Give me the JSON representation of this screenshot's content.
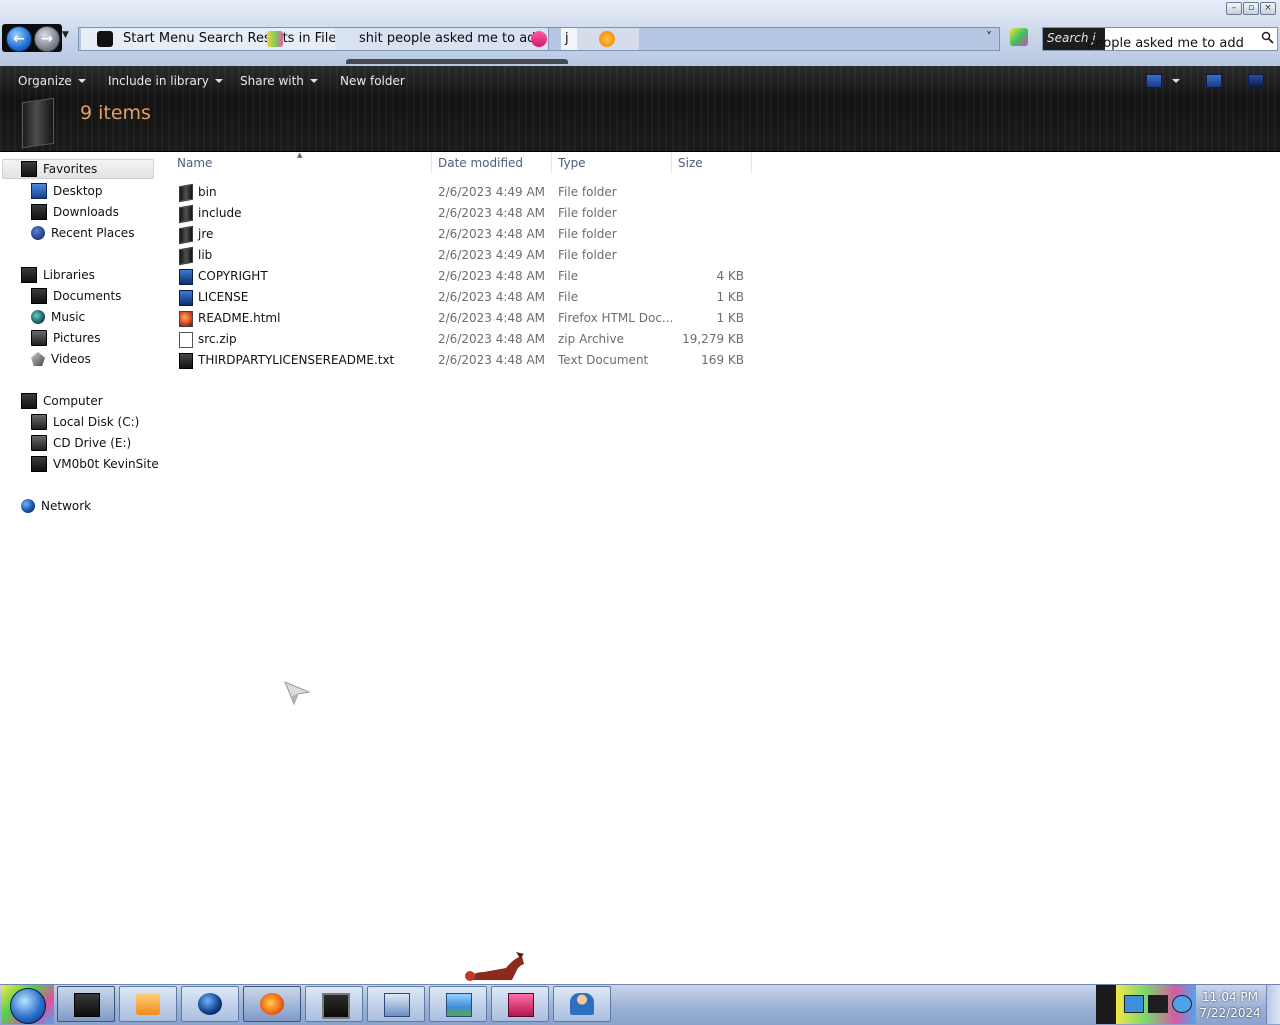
{
  "window": {
    "controls": [
      "minimize",
      "maximize",
      "close"
    ]
  },
  "address_bar": {
    "crumbs": [
      "Start Menu Search Results in Files",
      "shit people asked me to add",
      "j",
      ""
    ],
    "dropdown_glyph": "˅",
    "search_placeholder": "Search j",
    "search_echo": "people asked me to add"
  },
  "command_bar": {
    "organize": "Organize",
    "include_in_library": "Include in library",
    "share_with": "Share with",
    "new_folder": "New folder"
  },
  "details": {
    "item_count": "9 items"
  },
  "navigation": {
    "favorites": {
      "label": "Favorites",
      "items": [
        "Desktop",
        "Downloads",
        "Recent Places"
      ]
    },
    "libraries": {
      "label": "Libraries",
      "items": [
        "Documents",
        "Music",
        "Pictures",
        "Videos"
      ]
    },
    "computer": {
      "label": "Computer",
      "items": [
        "Local Disk (C:)",
        "CD Drive (E:)",
        "VM0b0t KevinSite"
      ]
    },
    "network": {
      "label": "Network"
    }
  },
  "columns": {
    "name": "Name",
    "date_modified": "Date modified",
    "type": "Type",
    "size": "Size"
  },
  "files": [
    {
      "name": "bin",
      "date": "2/6/2023 4:49 AM",
      "type": "File folder",
      "size": "",
      "icon": "folder-icon"
    },
    {
      "name": "include",
      "date": "2/6/2023 4:48 AM",
      "type": "File folder",
      "size": "",
      "icon": "folder-icon"
    },
    {
      "name": "jre",
      "date": "2/6/2023 4:48 AM",
      "type": "File folder",
      "size": "",
      "icon": "folder-icon"
    },
    {
      "name": "lib",
      "date": "2/6/2023 4:49 AM",
      "type": "File folder",
      "size": "",
      "icon": "folder-icon"
    },
    {
      "name": "COPYRIGHT",
      "date": "2/6/2023 4:48 AM",
      "type": "File",
      "size": "4 KB",
      "icon": "file-icon"
    },
    {
      "name": "LICENSE",
      "date": "2/6/2023 4:48 AM",
      "type": "File",
      "size": "1 KB",
      "icon": "file-icon"
    },
    {
      "name": "README.html",
      "date": "2/6/2023 4:48 AM",
      "type": "Firefox HTML Doc...",
      "size": "1 KB",
      "icon": "html-file-icon"
    },
    {
      "name": "src.zip",
      "date": "2/6/2023 4:48 AM",
      "type": "zip Archive",
      "size": "19,279 KB",
      "icon": "zip-file-icon"
    },
    {
      "name": "THIRDPARTYLICENSEREADME.txt",
      "date": "2/6/2023 4:48 AM",
      "type": "Text Document",
      "size": "169 KB",
      "icon": "text-file-icon"
    }
  ],
  "taskbar": {
    "buttons": [
      "explorer-window-icon",
      "media-player-icon",
      "globe-browser-icon",
      "firefox-icon",
      "monitor-app-icon",
      "keyboard-computer-icon",
      "picture-viewer-icon",
      "toolbox-icon",
      "user-figure-icon"
    ],
    "active_buttons": [
      "explorer-window-icon",
      "firefox-icon"
    ],
    "clock_time": "11:04 PM",
    "clock_date": "7/22/2024"
  }
}
